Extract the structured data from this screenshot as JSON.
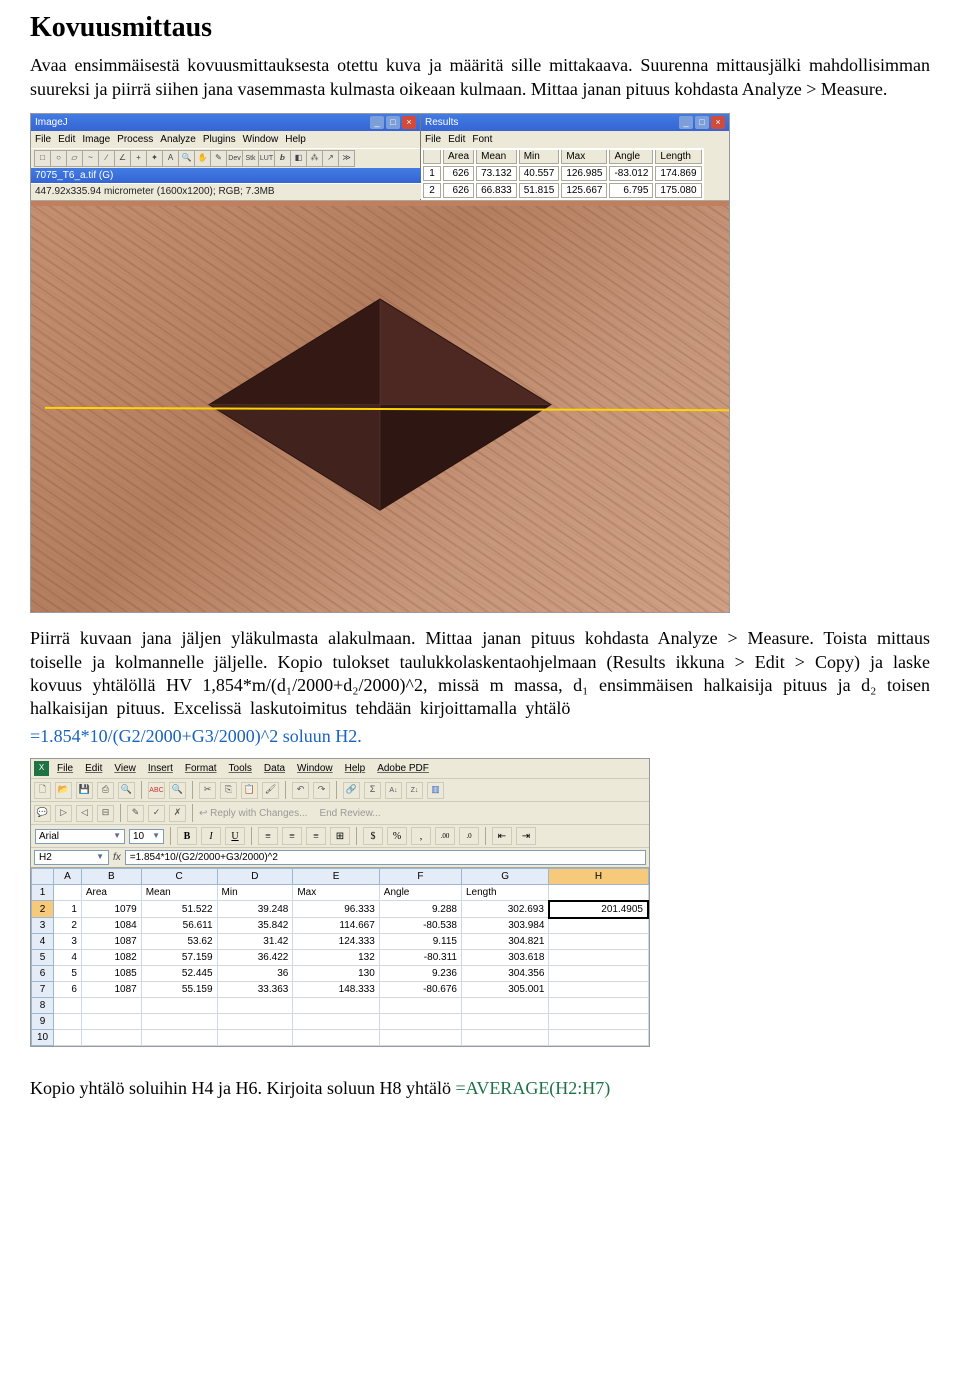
{
  "title": "Kovuusmittaus",
  "intro": "Avaa ensimmäisestä kovuusmittauksesta otettu kuva ja määritä sille mittakaava. Suurenna mittausjälki mahdollisimman suureksi ja piirrä siihen jana vasemmasta kulmasta oikeaan kulmaan. Mittaa janan pituus kohdasta Analyze > Measure.",
  "mid_para": "Piirrä kuvaan jana jäljen yläkulmasta alakulmaan. Mittaa janan pituus kohdasta Analyze > Measure. Toista mittaus toiselle ja kolmannelle jäljelle. Kopio tulokset taulukkolaskentaohjelmaan (Results ikkuna > Edit > Copy) ja laske kovuus yhtälöllä HV 1,854*m/(d₁/2000+d₂/2000)^2, missä m massa, d₁ ensimmäisen halkaisija pituus ja d₂ toisen halkaisijan pituus. Excelissä laskutoimitus tehdään kirjoittamalla yhtälö",
  "formula_line": " =1.854*10/(G2/2000+G3/2000)^2 soluun H2.",
  "footer_a": "Kopio yhtälö soluihin H4 ja H6. Kirjoita soluun H8 yhtälö ",
  "footer_b": "=AVERAGE(H2:H7)",
  "imagej": {
    "title": "ImageJ",
    "menus": [
      "File",
      "Edit",
      "Image",
      "Process",
      "Analyze",
      "Plugins",
      "Window",
      "Help"
    ],
    "imgtitle": "7075_T6_a.tif (G)",
    "status": "447.92x335.94 micrometer (1600x1200); RGB; 7.3MB"
  },
  "results": {
    "title": "Results",
    "menus": [
      "File",
      "Edit",
      "Font"
    ],
    "headers": [
      "",
      "Area",
      "Mean",
      "Min",
      "Max",
      "Angle",
      "Length"
    ],
    "rows": [
      [
        "1",
        "626",
        "73.132",
        "40.557",
        "126.985",
        "-83.012",
        "174.869"
      ],
      [
        "2",
        "626",
        "66.833",
        "51.815",
        "125.667",
        "6.795",
        "175.080"
      ]
    ]
  },
  "excel": {
    "menus": [
      "File",
      "Edit",
      "View",
      "Insert",
      "Format",
      "Tools",
      "Data",
      "Window",
      "Help",
      "Adobe PDF"
    ],
    "reply": "Reply with Changes...",
    "endrev": "End Review...",
    "font": "Arial",
    "size": "10",
    "cell": "H2",
    "formula": "=1.854*10/(G2/2000+G3/2000)^2",
    "cols": [
      "",
      "A",
      "B",
      "C",
      "D",
      "E",
      "F",
      "G",
      "H"
    ],
    "hdr": [
      "1",
      "",
      "Area",
      "Mean",
      "Min",
      "Max",
      "Angle",
      "Length",
      ""
    ],
    "rows": [
      [
        "2",
        "1",
        "1079",
        "51.522",
        "39.248",
        "96.333",
        "9.288",
        "302.693",
        "201.4905"
      ],
      [
        "3",
        "2",
        "1084",
        "56.611",
        "35.842",
        "114.667",
        "-80.538",
        "303.984",
        ""
      ],
      [
        "4",
        "3",
        "1087",
        "53.62",
        "31.42",
        "124.333",
        "9.115",
        "304.821",
        ""
      ],
      [
        "5",
        "4",
        "1082",
        "57.159",
        "36.422",
        "132",
        "-80.311",
        "303.618",
        ""
      ],
      [
        "6",
        "5",
        "1085",
        "52.445",
        "36",
        "130",
        "9.236",
        "304.356",
        ""
      ],
      [
        "7",
        "6",
        "1087",
        "55.159",
        "33.363",
        "148.333",
        "-80.676",
        "305.001",
        ""
      ],
      [
        "8",
        "",
        "",
        "",
        "",
        "",
        "",
        "",
        ""
      ],
      [
        "9",
        "",
        "",
        "",
        "",
        "",
        "",
        "",
        ""
      ],
      [
        "10",
        "",
        "",
        "",
        "",
        "",
        "",
        "",
        ""
      ]
    ]
  }
}
